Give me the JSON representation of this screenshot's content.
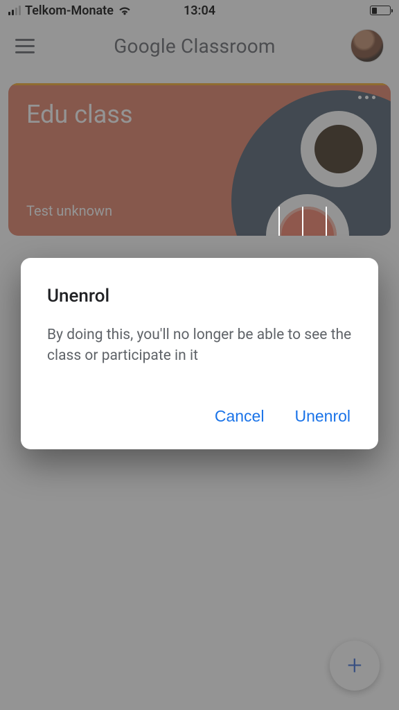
{
  "status_bar": {
    "carrier": "Telkom-Monate",
    "time": "13:04"
  },
  "header": {
    "title": "Google Classroom"
  },
  "class_card": {
    "name": "Edu class",
    "teacher": "Test unknown",
    "accent_color": "#e07a5f"
  },
  "fab": {
    "icon_glyph": "+"
  },
  "dialog": {
    "title": "Unenrol",
    "body": "By doing this, you'll no longer be able to see the class or participate in it",
    "cancel_label": "Cancel",
    "confirm_label": "Unenrol",
    "action_color": "#1a73e8"
  }
}
